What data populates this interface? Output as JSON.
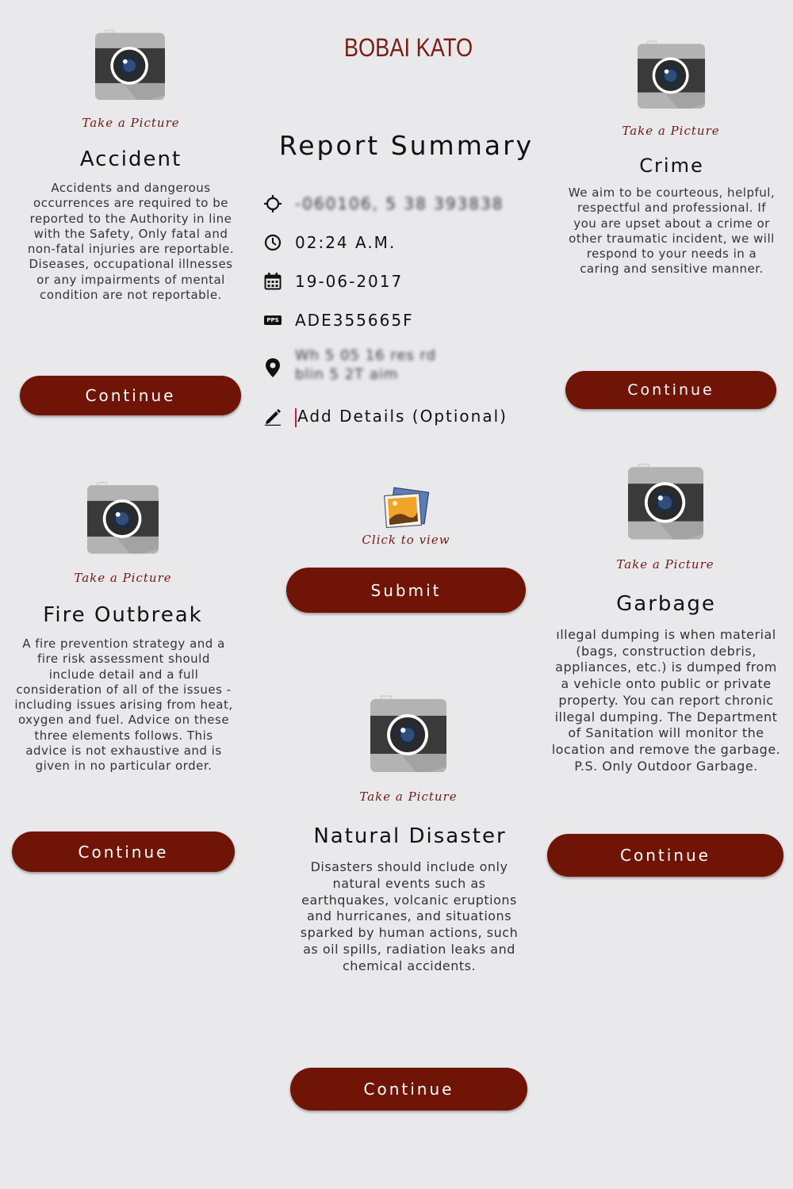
{
  "brand": "BOBAI KATO",
  "summary": {
    "title": "Report Summary",
    "coordinates": "-060106, 5 38 393838",
    "time": "02:24 A.M.",
    "date": "19-06-2017",
    "pps_badge": "PPS",
    "pps_number": "ADE355665F",
    "location_line1": "Wh 5 05  16  res  rd",
    "location_line2": "blin   5  2T  aim",
    "details_placeholder": "Add Details (Optional)",
    "view_label": "Click to view",
    "submit_label": "Submit"
  },
  "take_picture": "Take a Picture",
  "continue_label": "Continue",
  "cards": {
    "accident": {
      "title": "Accident",
      "desc": "Accidents and dangerous occurrences are required to be reported to the Authority in line with the Safety, Only fatal and non-fatal injuries are reportable. Diseases, occupational illnesses or any impairments of mental condition are not reportable."
    },
    "crime": {
      "title": "Crime",
      "desc": "We aim to be courteous, helpful, respectful and professional. If you are upset about a crime or other traumatic incident, we will respond to your needs in a caring and sensitive manner."
    },
    "fire": {
      "title": "Fire Outbreak",
      "desc": "A fire prevention strategy and a fire risk assessment should include detail and a full consideration of all of the issues - including issues arising from heat, oxygen and fuel. Advice on these three elements follows. This advice is not exhaustive and is given in no particular order."
    },
    "garbage": {
      "title": "Garbage",
      "desc": "ıllegal dumping is when material (bags, construction debris, appliances, etc.) is dumped from a vehicle onto public or private property. You can report chronic illegal dumping. The Department of Sanitation will monitor the location and remove the garbage. P.S. Only Outdoor Garbage."
    },
    "natural": {
      "title": "Natural Disaster",
      "desc": "Disasters should include only natural events such as earthquakes, volcanic eruptions and hurricanes, and situations sparked by human actions, such as oil spills, radiation leaks and chemical accidents."
    }
  },
  "colors": {
    "background": "#e9e9eb",
    "button": "#701407",
    "brand": "#7a1d13",
    "accent_label": "#6e1a16",
    "caret": "#c21d4b"
  },
  "icons": [
    "camera-icon",
    "crosshair-icon",
    "clock-icon",
    "calendar-icon",
    "pps-icon",
    "location-pin-icon",
    "pencil-icon",
    "image-gallery-icon"
  ]
}
